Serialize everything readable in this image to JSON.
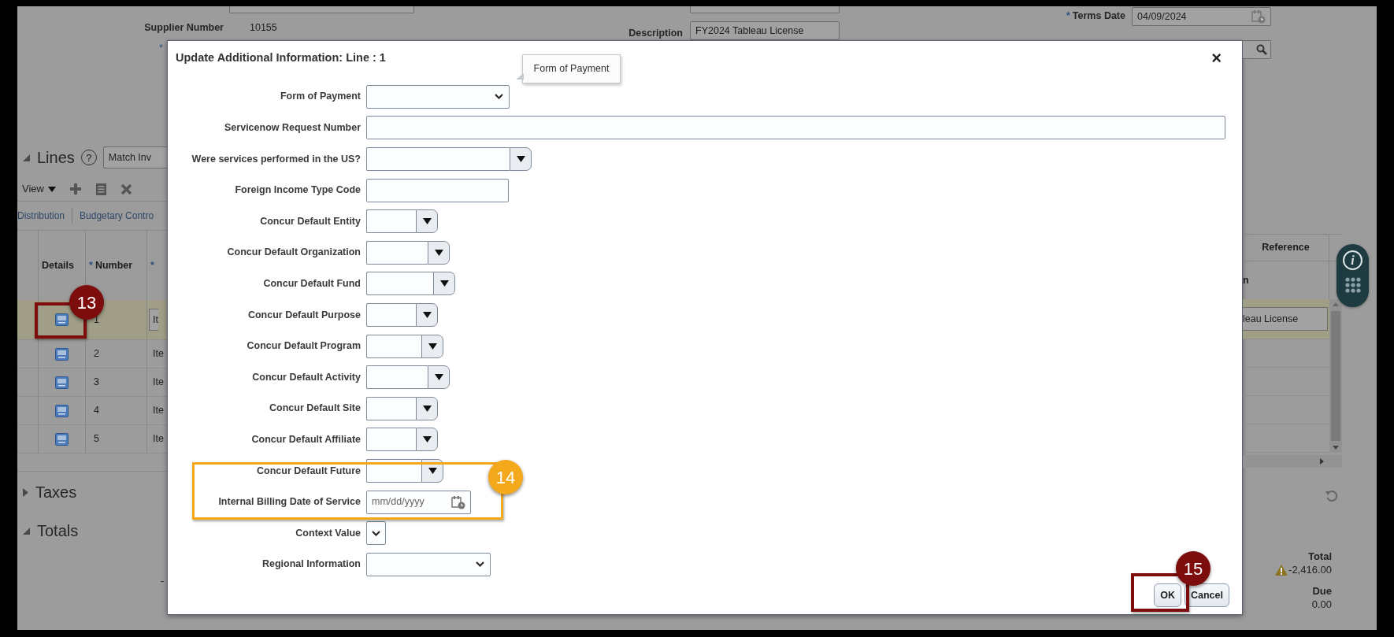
{
  "header": {
    "required_mark": "*",
    "supplier_number": {
      "label": "Supplier Number",
      "value": "10155"
    },
    "description": {
      "label": "Description",
      "value": "FY2024 Tableau License"
    },
    "terms_date": {
      "mark": "*",
      "label": "Terms Date",
      "value": "04/09/2024"
    }
  },
  "lines": {
    "title": "Lines",
    "expanded": true,
    "help": "?",
    "button": "Match Inv",
    "view_menu": "View",
    "tabs": [
      {
        "label": "Distribution"
      },
      {
        "label": "Budgetary Contro"
      }
    ],
    "columns": [
      {
        "label": "Details"
      },
      {
        "mark": "*",
        "label": "Number"
      },
      {
        "mark": "*"
      }
    ],
    "right_columns": {
      "header": "Reference",
      "subheader": "n"
    },
    "rows": [
      {
        "number": "1",
        "column_3": "It",
        "reference": "leau License",
        "selected": true
      },
      {
        "number": "2",
        "column_3": "Ite",
        "selected": false
      },
      {
        "number": "3",
        "column_3": "Ite",
        "selected": false
      },
      {
        "number": "4",
        "column_3": "Ite",
        "selected": false
      },
      {
        "number": "5",
        "column_3": "Ite",
        "selected": false
      }
    ]
  },
  "sections": [
    {
      "title": "Taxes",
      "expanded": false
    },
    {
      "title": "Totals",
      "expanded": true
    }
  ],
  "totals": {
    "dash": "-",
    "total_label": "Total",
    "total": "-2,416.00",
    "warning": true,
    "due_label": "Due",
    "due": "0.00"
  },
  "info_pill": {
    "glyph": "i"
  },
  "dialog": {
    "title": "Update Additional Information: Line : 1",
    "close": "×",
    "tooltip": "Form of Payment",
    "fields": [
      {
        "label": "Form of Payment",
        "kind": "select"
      },
      {
        "label": "Servicenow Request Number",
        "kind": "text"
      },
      {
        "label": "Were services performed in the US?",
        "kind": "combo"
      },
      {
        "label": "Foreign Income Type Code",
        "kind": "text"
      },
      {
        "label": "Concur Default Entity",
        "kind": "combo"
      },
      {
        "label": "Concur Default Organization",
        "kind": "combo"
      },
      {
        "label": "Concur Default Fund",
        "kind": "combo"
      },
      {
        "label": "Concur Default Purpose",
        "kind": "combo"
      },
      {
        "label": "Concur Default Program",
        "kind": "combo"
      },
      {
        "label": "Concur Default Activity",
        "kind": "combo"
      },
      {
        "label": "Concur Default Site",
        "kind": "combo"
      },
      {
        "label": "Concur Default Affiliate",
        "kind": "combo"
      },
      {
        "label": "Concur Default Future",
        "kind": "combo"
      },
      {
        "label": "Internal Billing Date of Service",
        "kind": "date",
        "placeholder": "mm/dd/yyyy"
      },
      {
        "label": "Context Value",
        "kind": "select"
      },
      {
        "label": "Regional Information",
        "kind": "select"
      }
    ],
    "buttons": [
      "OK",
      "Cancel"
    ]
  },
  "callouts": [
    {
      "number": "13",
      "color": "#7d0c0c"
    },
    {
      "number": "14",
      "color": "#f4a81c"
    },
    {
      "number": "15",
      "color": "#7d0c0c"
    }
  ]
}
